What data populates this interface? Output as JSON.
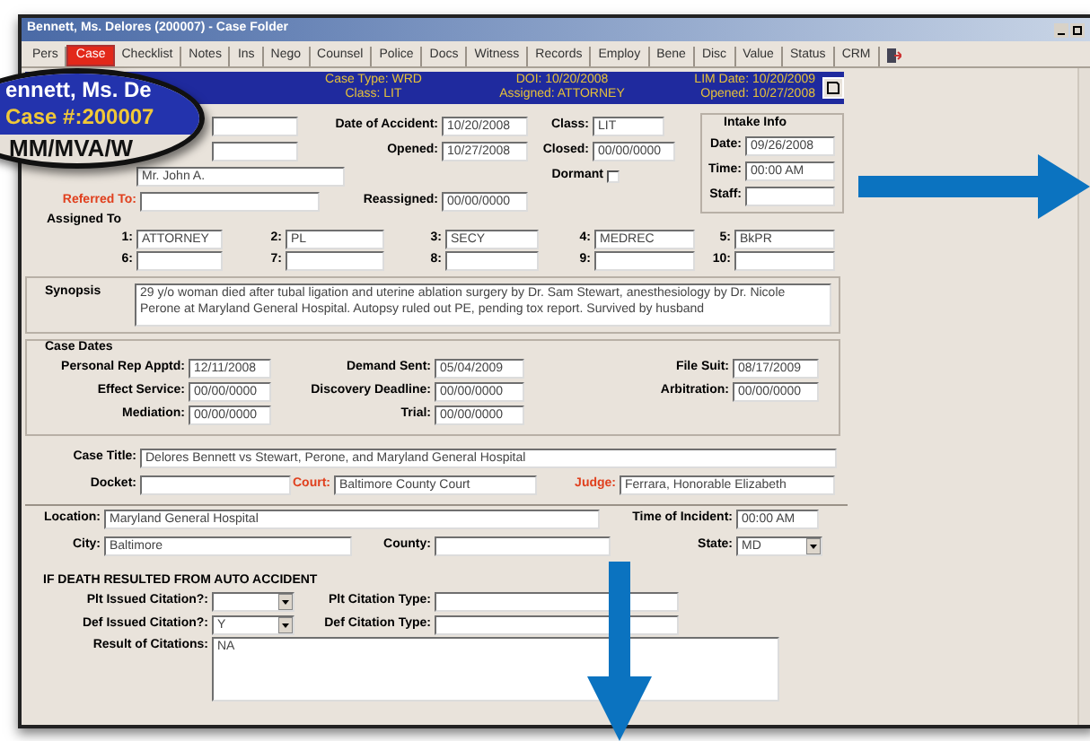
{
  "window": {
    "title": "Bennett, Ms. Delores (200007) - Case Folder"
  },
  "tabs": [
    {
      "label": "Pers",
      "selected": false
    },
    {
      "label": "Case",
      "selected": true
    },
    {
      "label": "Checklist",
      "selected": false
    },
    {
      "label": "Notes",
      "selected": false
    },
    {
      "label": "Ins",
      "selected": false
    },
    {
      "label": "Nego",
      "selected": false
    },
    {
      "label": "Counsel",
      "selected": false
    },
    {
      "label": "Police",
      "selected": false
    },
    {
      "label": "Docs",
      "selected": false
    },
    {
      "label": "Witness",
      "selected": false
    },
    {
      "label": "Records",
      "selected": false
    },
    {
      "label": "Employ",
      "selected": false
    },
    {
      "label": "Bene",
      "selected": false
    },
    {
      "label": "Disc",
      "selected": false
    },
    {
      "label": "Value",
      "selected": false
    },
    {
      "label": "Status",
      "selected": false
    },
    {
      "label": "CRM",
      "selected": false
    }
  ],
  "header": {
    "row_1": [
      "Case Type: WRD",
      "DOI: 10/20/2008",
      "LIM Date: 10/20/2009"
    ],
    "row_2": [
      "Class: LIT",
      "Assigned: ATTORNEY",
      "Opened: 10/27/2008"
    ]
  },
  "magnifier": {
    "lines": [
      "ennett, Ms. De",
      "Case #:200007",
      "MM/MVA/W"
    ]
  },
  "case_info": {
    "date_of_accident": {
      "label": "Date of Accident:",
      "value": "10/20/2008"
    },
    "class": {
      "label": "Class:",
      "value": "LIT"
    },
    "opened": {
      "label": "Opened:",
      "value": "10/27/2008"
    },
    "closed": {
      "label": "Closed:",
      "value": "00/00/0000"
    },
    "referred_by": {
      "value": "Mr. John A."
    },
    "dormant": {
      "label": "Dormant",
      "checked": false
    },
    "referred_to": {
      "label": "Referred To:"
    },
    "reassigned": {
      "label": "Reassigned:",
      "value": "00/00/0000"
    }
  },
  "intake_info": {
    "title": "Intake Info",
    "date": {
      "label": "Date:",
      "value": "09/26/2008"
    },
    "time": {
      "label": "Time:",
      "value": "00:00 AM"
    },
    "staff": {
      "label": "Staff:"
    }
  },
  "assigned_to": {
    "label": "Assigned To",
    "slots": [
      {
        "label": "1:",
        "value": "ATTORNEY"
      },
      {
        "label": "2:",
        "value": "PL"
      },
      {
        "label": "3:",
        "value": "SECY"
      },
      {
        "label": "4:",
        "value": "MEDREC"
      },
      {
        "label": "5:",
        "value": "BkPR"
      },
      {
        "label": "6:"
      },
      {
        "label": "7:"
      },
      {
        "label": "8:"
      },
      {
        "label": "9:"
      },
      {
        "label": "10:"
      }
    ]
  },
  "synopsis": {
    "label": "Synopsis",
    "text": "29 y/o woman died after tubal ligation and uterine ablation surgery by Dr. Sam Stewart, anesthesiology by Dr. Nicole Perone at Maryland General Hospital.  Autopsy ruled out PE, pending tox report.  Survived by husband"
  },
  "case_dates": {
    "title": "Case Dates",
    "columns": [
      [
        {
          "label": "Personal Rep Apptd:",
          "value": "12/11/2008"
        },
        {
          "label": "Effect Service:",
          "value": "00/00/0000"
        },
        {
          "label": "Mediation:",
          "value": "00/00/0000"
        }
      ],
      [
        {
          "label": "Demand Sent:",
          "value": "05/04/2009"
        },
        {
          "label": "Discovery Deadline:",
          "value": "00/00/0000"
        },
        {
          "label": "Trial:",
          "value": "00/00/0000"
        }
      ],
      [
        {
          "label": "File Suit:",
          "value": "08/17/2009"
        },
        {
          "label": "Arbitration:",
          "value": "00/00/0000"
        }
      ]
    ]
  },
  "case_title": {
    "label": "Case Title:",
    "value": "Delores Bennett vs Stewart, Perone, and Maryland General Hospital"
  },
  "docket": {
    "label": "Docket:"
  },
  "court": {
    "label": "Court:",
    "value": "Baltimore County Court"
  },
  "judge": {
    "label": "Judge:",
    "value": "Ferrara, Honorable Elizabeth"
  },
  "location": {
    "label": "Location:",
    "value": "Maryland General Hospital"
  },
  "time_of_incident": {
    "label": "Time of Incident:",
    "value": "00:00 AM"
  },
  "city": {
    "label": "City:",
    "value": "Baltimore"
  },
  "county": {
    "label": "County:"
  },
  "state": {
    "label": "State:",
    "value": "MD"
  },
  "auto_accident": {
    "title": "IF DEATH RESULTED FROM AUTO ACCIDENT",
    "plt_issued_citation": {
      "label": "Plt Issued Citation?:"
    },
    "plt_citation_type": {
      "label": "Plt Citation Type:"
    },
    "def_issued_citation": {
      "label": "Def Issued Citation?:",
      "value": "Y"
    },
    "def_citation_type": {
      "label": "Def Citation Type:"
    },
    "result_of_citations": {
      "label": "Result of Citations:",
      "value": "NA"
    }
  }
}
